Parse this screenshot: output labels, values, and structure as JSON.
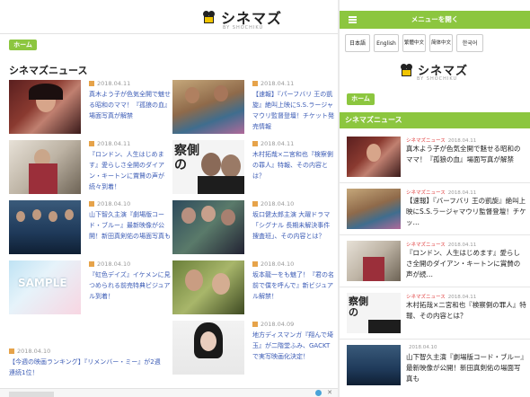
{
  "desktop": {
    "logo": {
      "text": "シネマズ",
      "sub": "BY SHOCHIKU"
    },
    "home_label": "ホーム",
    "section_title": "シネマズニュース",
    "articles": [
      {
        "date": "2018.04.11",
        "title": "真木よう子が色気全開で魅せる昭和のママ！『孤狼の血』場面写真が解禁"
      },
      {
        "date": "2018.04.11",
        "title": "【速報】『パーフバリ 王の凱旋』絶叫上映にS.S.ラージャマウリ監督登壇！チケット発売情報"
      },
      {
        "date": "2018.04.11",
        "title": "『ロンドン、人生はじめます』愛らしさ全開のダイアン・キートンに賞賛の声が続々到着！"
      },
      {
        "date": "2018.04.11",
        "title": "木村拓哉×二宮和也『検察側の罪人』特報、その内容とは？"
      },
      {
        "date": "2018.04.10",
        "title": "山下智久主演『劇場版コード・ブルー』最新映像が公開！新田真剣佑の場面写真も"
      },
      {
        "date": "2018.04.10",
        "title": "坂口健太郎主演 大躍ドラマ「シグナル 長期未解決事件捜査班」、その内容とは？"
      },
      {
        "date": "2018.04.10",
        "title": "『虹色デイズ』イケメンに見つめられる前売特典ビジュアル到着！"
      },
      {
        "date": "2018.04.10",
        "title": "坂本龍一をも魅了！『君の名前で僕を呼んで』新ビジュアル解禁！"
      },
      {
        "date": "2018.04.09",
        "title": "地方ディスマンガ『翔んで埼玉』が二階堂ふみ、GACKTで実写映画化決定！"
      }
    ],
    "last_article": {
      "date": "2018.04.10",
      "title": "【今週の映画ランキング】『リメンバー・ミー』が2週連続1位！"
    },
    "ad_close": "✕"
  },
  "mobile": {
    "menu_label": "メニューを開く",
    "languages": [
      "日本語",
      "English",
      "繁體中文",
      "简体中文",
      "한국어"
    ],
    "logo": {
      "text": "シネマズ",
      "sub": "BY SHOCHIKU"
    },
    "home_label": "ホーム",
    "section_title": "シネマズニュース",
    "articles": [
      {
        "category": "シネマズニュース",
        "date": "2018.04.11",
        "title": "真木よう子が色気全開で魅せる昭和のママ！『孤狼の血』場面写真が解禁"
      },
      {
        "category": "シネマズニュース",
        "date": "2018.04.11",
        "title": "【速報】『バーフバリ 王の凱旋』絶叫上映にS.S.ラージャマウリ監督登壇！チケッ…"
      },
      {
        "category": "シネマズニュース",
        "date": "2018.04.11",
        "title": "『ロンドン、人生はじめます』愛らしさ全開のダイアン・キートンに賞賛の声が続…"
      },
      {
        "category": "シネマズニュース",
        "date": "2018.04.11",
        "title": "木村拓哉×二宮和也『検察側の罪人』特報、その内容とは？"
      },
      {
        "category": "",
        "date": "2018.04.10",
        "title": "山下智久主演『劇場版コード・ブルー』最新映像が公開！新田真剣佑の場面写真も"
      }
    ]
  },
  "colors": {
    "accent": "#8cc63f",
    "link": "#3b5bb5",
    "category": "#e03c3c"
  }
}
